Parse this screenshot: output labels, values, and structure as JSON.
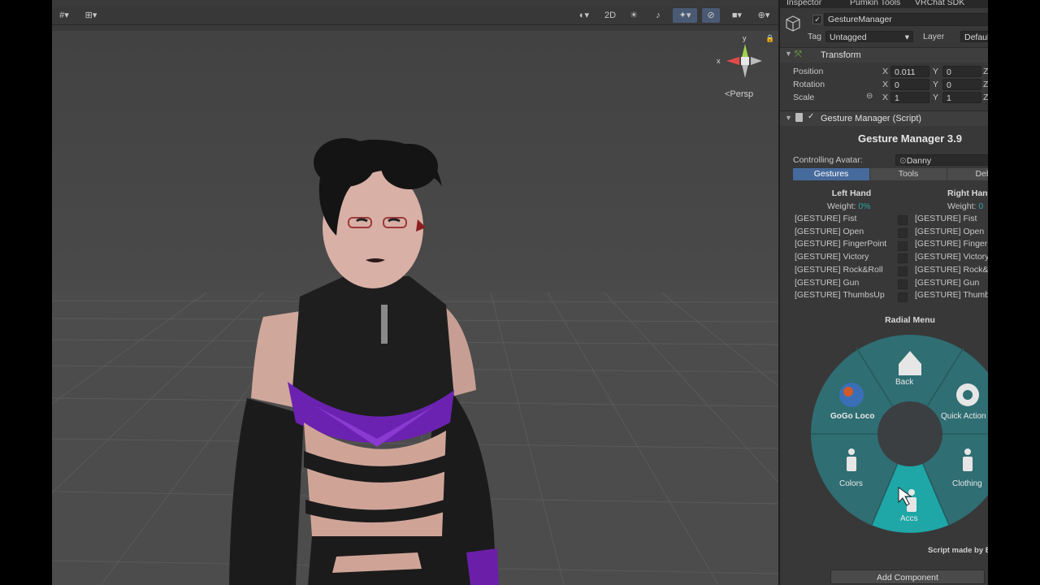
{
  "scene": {
    "toolbar": {
      "btn_2d": "2D"
    },
    "persp_label": "<Persp"
  },
  "inspector": {
    "tabs": [
      "Inspector",
      "Pumkin Tools",
      "VRChat SDK"
    ],
    "object_name": "GestureManager",
    "tag_label": "Tag",
    "tag_value": "Untagged",
    "layer_label": "Layer",
    "layer_value": "Default",
    "transform": {
      "title": "Transform",
      "position_label": "Position",
      "rotation_label": "Rotation",
      "scale_label": "Scale",
      "position": {
        "x": "0.011",
        "y": "0"
      },
      "rotation": {
        "x": "0",
        "y": "0"
      },
      "scale": {
        "x": "1",
        "y": "1"
      },
      "x_label": "X",
      "y_label": "Y",
      "z_label": "Z"
    },
    "gesture_manager": {
      "component_title": "Gesture Manager (Script)",
      "heading": "Gesture Manager 3.9",
      "controlling_label": "Controlling Avatar:",
      "controlling_value": "Danny",
      "tabs": [
        "Gestures",
        "Tools",
        "Debu"
      ],
      "left_hand": {
        "title": "Left Hand",
        "weight_label": "Weight:",
        "weight_value": "0%",
        "items": [
          "[GESTURE] Fist",
          "[GESTURE] Open",
          "[GESTURE] FingerPoint",
          "[GESTURE] Victory",
          "[GESTURE] Rock&Roll",
          "[GESTURE] Gun",
          "[GESTURE] ThumbsUp"
        ]
      },
      "right_hand": {
        "title": "Right Hand",
        "weight_label": "Weight:",
        "weight_value": "0",
        "items": [
          "[GESTURE] Fist",
          "[GESTURE] Open",
          "[GESTURE] FingerP",
          "[GESTURE] Victory",
          "[GESTURE] Rock&R",
          "[GESTURE] Gun",
          "[GESTURE] Thumbs"
        ]
      },
      "radial_title": "Radial Menu",
      "radial_items": {
        "back": "Back",
        "quick_actions": "Quick Action",
        "gogo_loco": "GoGo Loco",
        "colors": "Colors",
        "clothing": "Clothing",
        "accs": "Accs"
      },
      "footer": "Script made by B"
    },
    "add_component": "Add Component"
  },
  "colors": {
    "radial_bg": "#2f6e73",
    "radial_selected": "#1fa7a7",
    "active_tab": "#466a9c",
    "weight_color": "#2fa3a3"
  }
}
